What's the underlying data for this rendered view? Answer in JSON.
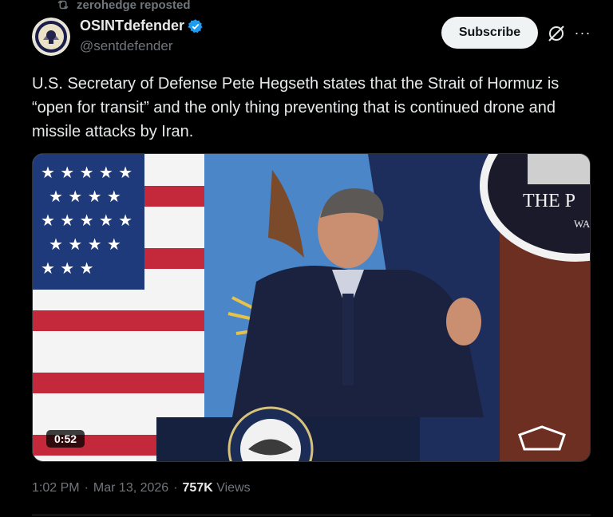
{
  "repost": {
    "text": "zerohedge reposted",
    "icon": "repost-icon"
  },
  "author": {
    "display_name": "OSINTdefender",
    "handle": "@sentdefender",
    "verified": true,
    "verified_color": "#1d9bf0"
  },
  "actions": {
    "subscribe_label": "Subscribe",
    "grok_icon": "grok-icon",
    "more_icon": "more-icon"
  },
  "tweet": {
    "text": "U.S. Secretary of Defense Pete Hegseth states that the Strait of Hormuz is “open for transit” and the only thing preventing that is continued drone and missile attacks by Iran."
  },
  "media": {
    "duration": "0:52",
    "backdrop_text": "THE P",
    "backdrop_subtext": "WA",
    "seal_text": "DEPARTMENT OF WAR"
  },
  "meta": {
    "time": "1:02 PM",
    "separator": "·",
    "date": "Mar 13, 2026",
    "views_count": "757K",
    "views_label": "Views"
  }
}
